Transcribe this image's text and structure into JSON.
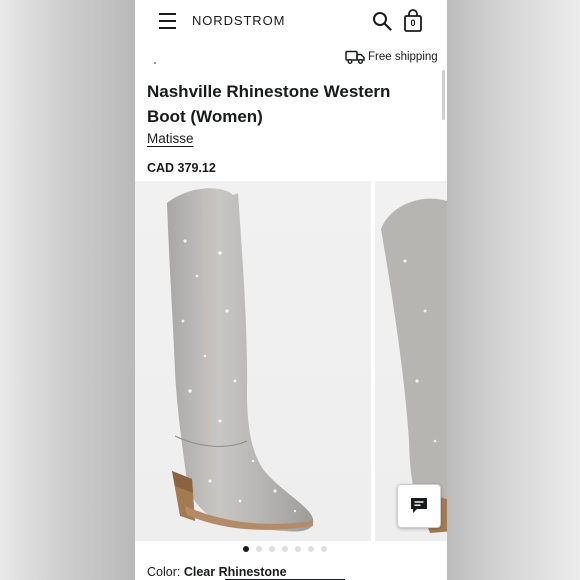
{
  "header": {
    "logo": "NORDSTROM",
    "bag_count": "0"
  },
  "shipping": {
    "label": "Free shipping"
  },
  "product": {
    "title": "Nashville Rhinestone Western Boot (Women)",
    "brand": "Matisse",
    "price": "CAD 379.12",
    "color_label": "Color:",
    "color_value": "Clear Rhinestone"
  },
  "gallery": {
    "image_count": 7,
    "active_index": 0
  },
  "icons": {
    "menu": "hamburger-menu-icon",
    "search": "search-icon",
    "bag": "shopping-bag-icon",
    "truck": "truck-icon",
    "chat": "chat-icon"
  },
  "colors": {
    "text": "#191a1b",
    "background": "#ffffff",
    "dot_inactive": "#dedede"
  }
}
